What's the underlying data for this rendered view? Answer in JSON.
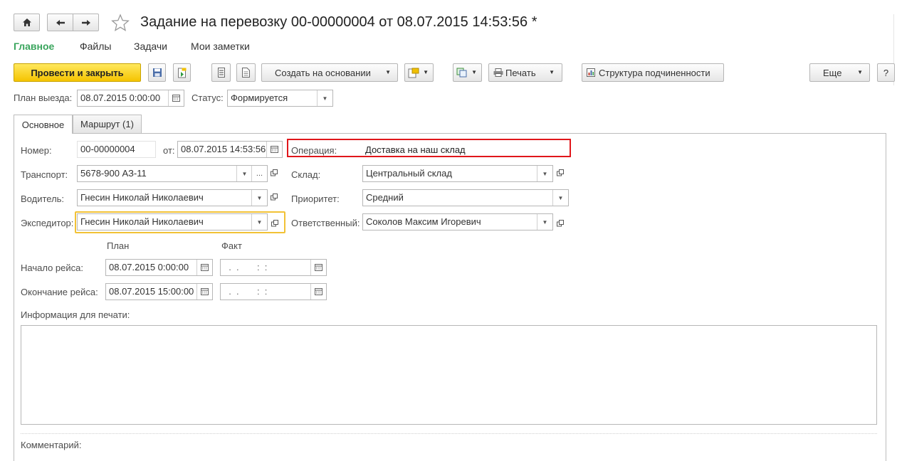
{
  "window": {
    "title": "Задание на перевозку 00-00000004 от 08.07.2015 14:53:56 *"
  },
  "nav": {
    "main": "Главное",
    "files": "Файлы",
    "tasks": "Задачи",
    "notes": "Мои заметки"
  },
  "toolbar": {
    "post_close": "Провести и закрыть",
    "create_based": "Создать на основании",
    "print": "Печать",
    "structure": "Структура подчиненности",
    "more": "Еще",
    "help": "?"
  },
  "header_fields": {
    "plan_label": "План выезда:",
    "plan_value": "08.07.2015  0:00:00",
    "status_label": "Статус:",
    "status_value": "Формируется"
  },
  "tabs": {
    "main": "Основное",
    "route": "Маршрут (1)"
  },
  "form": {
    "number_label": "Номер:",
    "number_value": "00-00000004",
    "from_label": "от:",
    "from_value": "08.07.2015 14:53:56",
    "operation_label": "Операция:",
    "operation_value": "Доставка на наш склад",
    "transport_label": "Транспорт:",
    "transport_value": "5678-900 АЗ-11",
    "warehouse_label": "Склад:",
    "warehouse_value": "Центральный склад",
    "driver_label": "Водитель:",
    "driver_value": "Гнесин Николай Николаевич",
    "priority_label": "Приоритет:",
    "priority_value": "Средний",
    "forwarder_label": "Экспедитор:",
    "forwarder_value": "Гнесин Николай Николаевич",
    "responsible_label": "Ответственный:",
    "responsible_value": "Соколов Максим Игоревич",
    "plan_col": "План",
    "fact_col": "Факт",
    "start_label": "Начало рейса:",
    "start_plan": "08.07.2015  0:00:00",
    "start_fact": "  .  .       :  :",
    "end_label": "Окончание рейса:",
    "end_plan": "08.07.2015 15:00:00",
    "end_fact": "  .  .       :  :",
    "print_info_label": "Информация для печати:",
    "comment_label": "Комментарий:"
  },
  "colors": {
    "accent_green": "#3aa55d",
    "primary_yellow": "#f5c400",
    "highlight_red": "#e0161b",
    "focus_yellow": "#f2c236"
  }
}
